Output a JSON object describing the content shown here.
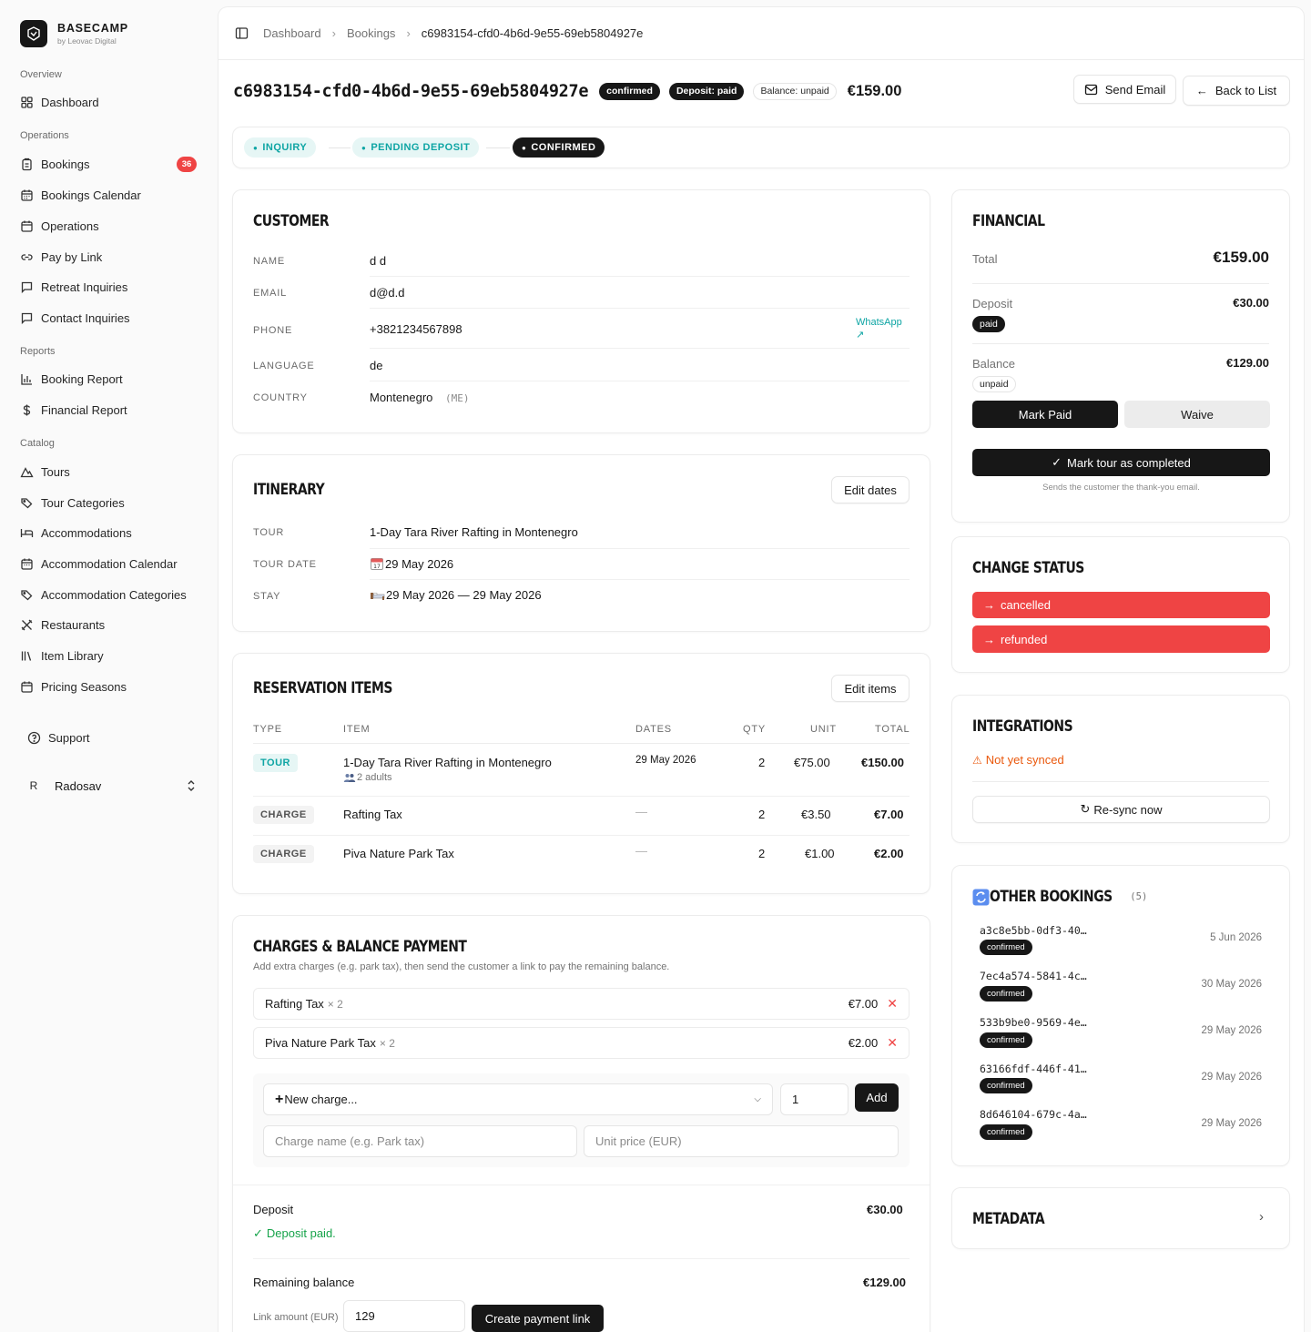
{
  "app": {
    "name": "BASECAMP",
    "subtitle": "by Leovac Digital"
  },
  "sidebar": {
    "sections": [
      {
        "label": "Overview",
        "items": [
          {
            "label": "Dashboard",
            "icon": "grid-icon"
          }
        ]
      },
      {
        "label": "Operations",
        "items": [
          {
            "label": "Bookings",
            "icon": "clipboard-icon",
            "badge": "36"
          },
          {
            "label": "Bookings Calendar",
            "icon": "calendar-icon"
          },
          {
            "label": "Operations",
            "icon": "calendar-icon"
          },
          {
            "label": "Pay by Link",
            "icon": "link-icon"
          },
          {
            "label": "Retreat Inquiries",
            "icon": "message-icon"
          },
          {
            "label": "Contact Inquiries",
            "icon": "message-icon"
          }
        ]
      },
      {
        "label": "Reports",
        "items": [
          {
            "label": "Booking Report",
            "icon": "bar-chart-icon"
          },
          {
            "label": "Financial Report",
            "icon": "dollar-icon"
          }
        ]
      },
      {
        "label": "Catalog",
        "items": [
          {
            "label": "Tours",
            "icon": "mountain-icon"
          },
          {
            "label": "Tour Categories",
            "icon": "tags-icon"
          },
          {
            "label": "Accommodations",
            "icon": "bed-icon"
          },
          {
            "label": "Accommodation Calendar",
            "icon": "calendar-icon"
          },
          {
            "label": "Accommodation Categories",
            "icon": "tags-icon"
          },
          {
            "label": "Restaurants",
            "icon": "utensils-icon"
          },
          {
            "label": "Item Library",
            "icon": "library-icon"
          },
          {
            "label": "Pricing Seasons",
            "icon": "calendar-icon"
          }
        ]
      }
    ],
    "support": "Support",
    "user": {
      "initial": "R",
      "name": "Radosav"
    }
  },
  "breadcrumb": [
    "Dashboard",
    "Bookings",
    "c6983154-cfd0-4b6d-9e55-69eb5804927e"
  ],
  "header": {
    "booking_id": "c6983154-cfd0-4b6d-9e55-69eb5804927e",
    "status": "confirmed",
    "deposit_badge": "Deposit: paid",
    "balance_badge": "Balance: unpaid",
    "total": "€159.00",
    "send_email": "Send Email",
    "back": "Back to List"
  },
  "progress": {
    "steps": [
      {
        "label": "INQUIRY",
        "state": "done"
      },
      {
        "label": "PENDING DEPOSIT",
        "state": "done"
      },
      {
        "label": "CONFIRMED",
        "state": "current"
      }
    ]
  },
  "customer": {
    "title": "CUSTOMER",
    "fields": [
      {
        "label": "NAME",
        "value": "d d"
      },
      {
        "label": "EMAIL",
        "value": "d@d.d"
      },
      {
        "label": "PHONE",
        "value": "+3821234567898"
      },
      {
        "label": "LANGUAGE",
        "value": "de"
      },
      {
        "label": "COUNTRY",
        "value": "Montenegro"
      }
    ],
    "country_code": "(ME)",
    "whatsapp": "WhatsApp",
    "whatsapp_arrow": "↗"
  },
  "itinerary": {
    "title": "ITINERARY",
    "edit": "Edit dates",
    "fields": [
      {
        "label": "TOUR",
        "value": "1-Day Tara River Rafting in Montenegro"
      },
      {
        "label": "TOUR DATE",
        "value": "29 May 2026"
      },
      {
        "label": "STAY",
        "value": "29 May 2026 — 29 May 2026"
      }
    ]
  },
  "reservation": {
    "title": "RESERVATION ITEMS",
    "edit": "Edit items",
    "columns": [
      "TYPE",
      "ITEM",
      "DATES",
      "QTY",
      "UNIT",
      "TOTAL"
    ],
    "rows": [
      {
        "type": "TOUR",
        "item": "1-Day Tara River Rafting in Montenegro",
        "sub": "2 adults",
        "dates": "29 May 2026",
        "qty": "2",
        "unit": "€75.00",
        "total": "€150.00"
      },
      {
        "type": "CHARGE",
        "item": "Rafting Tax",
        "sub": "",
        "dates": "—",
        "qty": "2",
        "unit": "€3.50",
        "total": "€7.00"
      },
      {
        "type": "CHARGE",
        "item": "Piva Nature Park Tax",
        "sub": "",
        "dates": "—",
        "qty": "2",
        "unit": "€1.00",
        "total": "€2.00"
      }
    ]
  },
  "charges": {
    "title": "CHARGES & BALANCE PAYMENT",
    "description": "Add extra charges (e.g. park tax), then send the customer a link to pay the remaining balance.",
    "items": [
      {
        "name": "Rafting Tax",
        "qty": "× 2",
        "amount": "€7.00"
      },
      {
        "name": "Piva Nature Park Tax",
        "qty": "× 2",
        "amount": "€2.00"
      }
    ],
    "new_charge": "New charge...",
    "qty_value": "1",
    "add": "Add",
    "name_placeholder": "Charge name (e.g. Park tax)",
    "price_placeholder": "Unit price (EUR)",
    "deposit_label": "Deposit",
    "deposit_amount": "€30.00",
    "deposit_status": "Deposit paid.",
    "remaining_label": "Remaining balance",
    "remaining_amount": "€129.00",
    "link_label": "Link amount (EUR)",
    "link_value": "129",
    "create_link": "Create payment link"
  },
  "financial": {
    "title": "FINANCIAL",
    "total_label": "Total",
    "total": "€159.00",
    "deposit_label": "Deposit",
    "deposit": "€30.00",
    "deposit_status": "paid",
    "balance_label": "Balance",
    "balance": "€129.00",
    "balance_status": "unpaid",
    "mark_paid": "Mark Paid",
    "waive": "Waive",
    "complete": "Mark tour as completed",
    "complete_note": "Sends the customer the thank-you email."
  },
  "change_status": {
    "title": "CHANGE STATUS",
    "options": [
      "cancelled",
      "refunded"
    ]
  },
  "integrations": {
    "title": "INTEGRATIONS",
    "warning": "Not yet synced",
    "resync": "Re-sync now"
  },
  "other_bookings": {
    "title": "OTHER BOOKINGS",
    "count": "(5)",
    "items": [
      {
        "id": "a3c8e5bb-0df3-40…",
        "status": "confirmed",
        "date": "5 Jun 2026"
      },
      {
        "id": "7ec4a574-5841-4c…",
        "status": "confirmed",
        "date": "30 May 2026"
      },
      {
        "id": "533b9be0-9569-4e…",
        "status": "confirmed",
        "date": "29 May 2026"
      },
      {
        "id": "63166fdf-446f-41…",
        "status": "confirmed",
        "date": "29 May 2026"
      },
      {
        "id": "8d646104-679c-4a…",
        "status": "confirmed",
        "date": "29 May 2026"
      }
    ]
  },
  "metadata": {
    "title": "METADATA"
  },
  "colors": {
    "accent": "#171717",
    "danger": "#ef4444",
    "teal": "#0ea5a4",
    "success": "#16a34a",
    "warning": "#ea580c"
  }
}
